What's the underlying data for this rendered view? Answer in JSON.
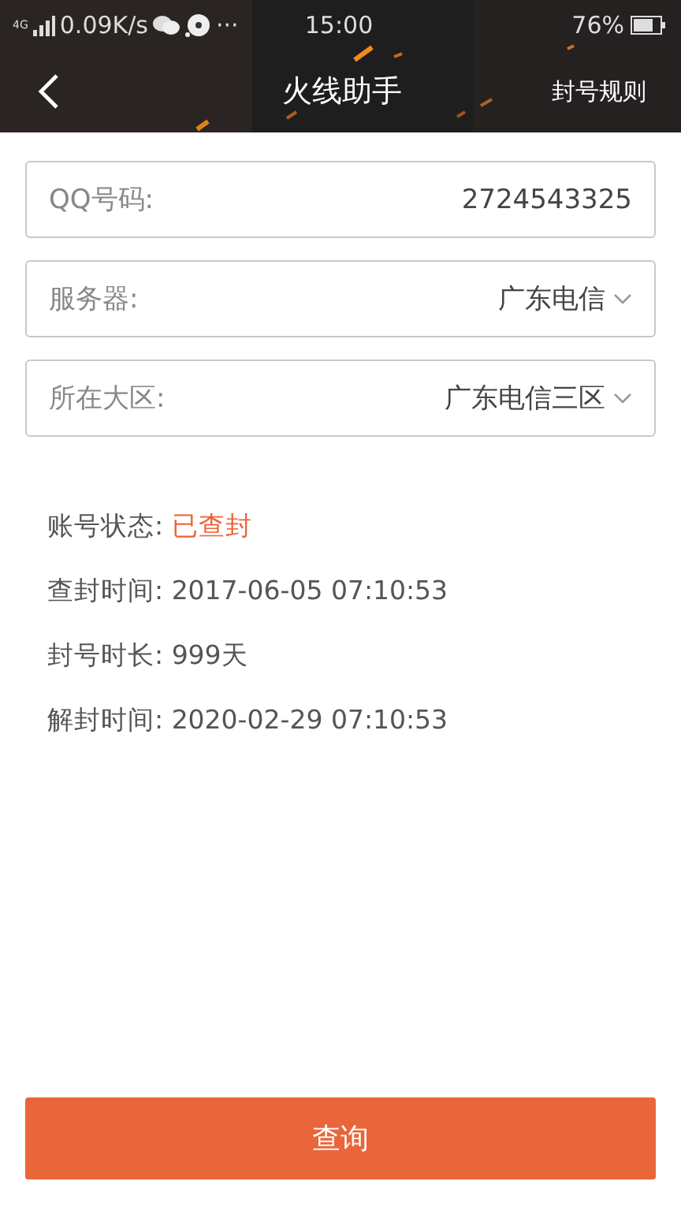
{
  "status_bar": {
    "network": "4G",
    "speed": "0.09K/s",
    "more": "···",
    "time": "15:00",
    "battery": "76%"
  },
  "nav": {
    "title": "火线助手",
    "action": "封号规则"
  },
  "fields": [
    {
      "kind": "input",
      "label": "QQ号码:",
      "value": "2724543325"
    },
    {
      "kind": "select",
      "label": "服务器:",
      "value": "广东电信"
    },
    {
      "kind": "select",
      "label": "所在大区:",
      "value": "广东电信三区"
    }
  ],
  "info": [
    {
      "label": "账号状态:",
      "value": "已查封",
      "alert": true
    },
    {
      "label": "查封时间:",
      "value": "2017-06-05 07:10:53",
      "alert": false
    },
    {
      "label": "封号时长:",
      "value": "999天",
      "alert": false
    },
    {
      "label": "解封时间:",
      "value": "2020-02-29 07:10:53",
      "alert": false
    }
  ],
  "button": "查询"
}
